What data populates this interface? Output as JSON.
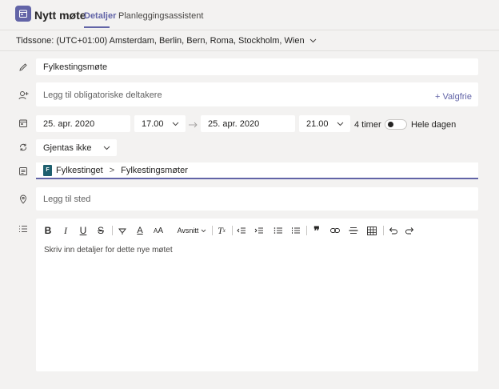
{
  "header": {
    "title": "Nytt møte",
    "tabs": [
      {
        "label": "Detaljer",
        "active": true
      },
      {
        "label": "Planleggingsassistent",
        "active": false
      }
    ]
  },
  "timezone": {
    "label": "Tidssone: (UTC+01:00) Amsterdam, Berlin, Bern, Roma, Stockholm, Wien"
  },
  "form": {
    "title_value": "Fylkestingsmøte",
    "attendees_placeholder": "Legg til obligatoriske deltakere",
    "optional_link": "+ Valgfrie",
    "start_date": "25. apr. 2020",
    "start_time": "17.00",
    "end_date": "25. apr. 2020",
    "end_time": "21.00",
    "duration": "4 timer",
    "all_day_label": "Hele dagen",
    "all_day_on": false,
    "repeat_value": "Gjentas ikke",
    "channel": {
      "team_initial": "F",
      "team": "Fylkestinget",
      "separator": ">",
      "channel": "Fylkestingsmøter"
    },
    "location_placeholder": "Legg til sted"
  },
  "editor": {
    "paragraph_style": "Avsnitt",
    "placeholder": "Skriv inn detaljer for dette nye møtet"
  },
  "colors": {
    "accent": "#6264a7",
    "background": "#f3f2f1",
    "field": "#ffffff"
  }
}
